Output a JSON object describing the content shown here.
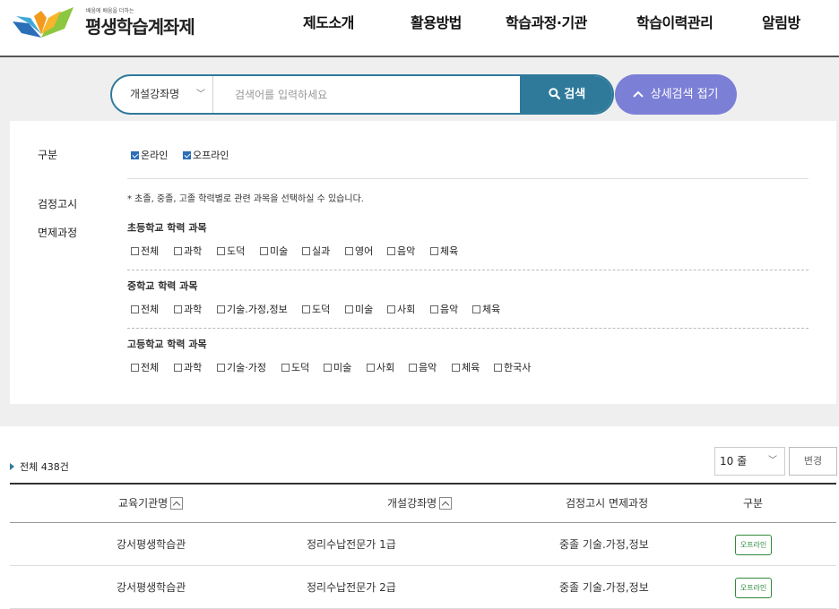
{
  "logo": {
    "tagline": "배움에 배움을 더하는",
    "title": "평생학습계좌제"
  },
  "nav": [
    "제도소개",
    "활용방법",
    "학습과정·기관",
    "학습이력관리",
    "알림방"
  ],
  "search": {
    "select_value": "개설강좌명",
    "placeholder": "검색어를 입력하세요",
    "search_label": "검색",
    "detail_label": "상세검색 접기"
  },
  "filters": {
    "category_label": "구분",
    "category_options": [
      {
        "label": "온라인",
        "checked": true
      },
      {
        "label": "오프라인",
        "checked": true
      }
    ],
    "exam_label_line1": "검정고시",
    "exam_label_line2": "면제과정",
    "note": "* 초졸, 중졸, 고졸 학력별로 관련 과목을 선택하실 수 있습니다.",
    "groups": [
      {
        "title": "초등학교 학력 과목",
        "options": [
          "전체",
          "과학",
          "도덕",
          "미술",
          "실과",
          "영어",
          "음악",
          "체육"
        ]
      },
      {
        "title": "중학교 학력 과목",
        "options": [
          "전체",
          "과학",
          "기술.가정,정보",
          "도덕",
          "미술",
          "사회",
          "음악",
          "체육"
        ]
      },
      {
        "title": "고등학교 학력 과목",
        "options": [
          "전체",
          "과학",
          "기술·가정",
          "도덕",
          "미술",
          "사회",
          "음악",
          "체육",
          "한국사"
        ]
      }
    ]
  },
  "results": {
    "total_label": "전체 438건",
    "page_size": "10 줄",
    "change_label": "변경",
    "columns": [
      "교육기관명",
      "개설강좌명",
      "검정고시 면제과정",
      "구분"
    ],
    "rows": [
      {
        "institution": "강서평생학습관",
        "course": "정리수납전문가 1급",
        "exemption": "중졸 기술.가정,정보",
        "type": "오프라인"
      },
      {
        "institution": "강서평생학습관",
        "course": "정리수납전문가 2급",
        "exemption": "중졸 기술.가정,정보",
        "type": "오프라인"
      }
    ]
  },
  "colors": {
    "primary": "#2f7a9a",
    "detail_button": "#7b7fd6",
    "badge": "#2e8a3a",
    "panel_bg": "#efefef"
  }
}
